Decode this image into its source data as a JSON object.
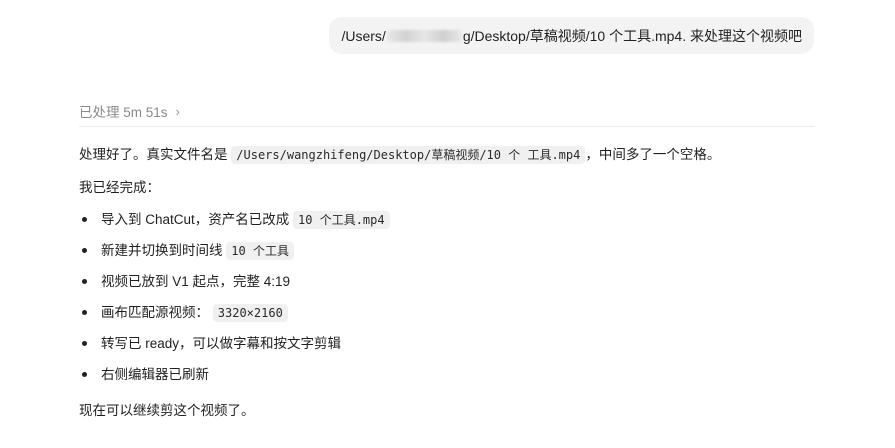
{
  "user_message": {
    "prefix": "/Users/",
    "suffix": "g/Desktop/草稿视频/10 个工具.mp4. 来处理这个视频吧"
  },
  "status": {
    "processed_label": "已处理 5m 51s",
    "chevron": "›"
  },
  "reply": {
    "p1_before": "处理好了。真实文件名是 ",
    "p1_code": "/Users/wangzhifeng/Desktop/草稿视频/10 个 工具.mp4",
    "p1_after": "，中间多了一个空格。",
    "p2": "我已经完成：",
    "items": [
      {
        "text": "导入到 ChatCut，资产名已改成 ",
        "code": "10 个工具.mp4"
      },
      {
        "text": "新建并切换到时间线 ",
        "code": "10 个工具"
      },
      {
        "text": "视频已放到 V1 起点，完整 4:19"
      },
      {
        "text": "画布匹配源视频： ",
        "code": "3320×2160"
      },
      {
        "text": "转写已 ready，可以做字幕和按文字剪辑"
      },
      {
        "text": "右侧编辑器已刷新"
      }
    ],
    "p3": "现在可以继续剪这个视频了。"
  }
}
